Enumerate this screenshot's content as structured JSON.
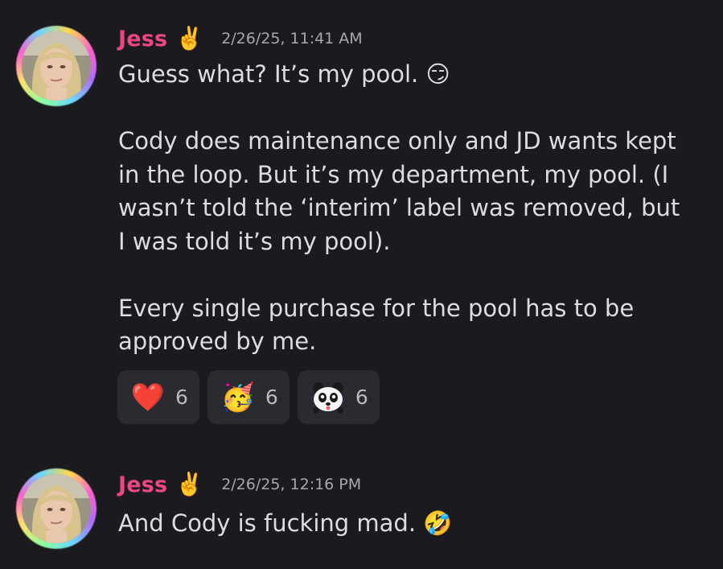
{
  "messages": [
    {
      "author": "Jess",
      "author_emoji": "✌️",
      "timestamp": "2/26/25, 11:41 AM",
      "paragraphs": [
        "Guess what? It’s my pool. 😏",
        "Cody does maintenance only and JD wants kept in the loop. But it’s my department, my pool. (I wasn’t told the ‘interim’ label was removed, but I was told it’s my pool).",
        "Every single purchase for the pool has to be approved by me."
      ],
      "reactions": [
        {
          "emoji": "❤️",
          "icon": "heart-icon",
          "count": "6"
        },
        {
          "emoji": "🥳",
          "icon": "party-face-icon",
          "count": "6"
        },
        {
          "emoji": "",
          "icon": "panda-icon",
          "count": "6"
        }
      ]
    },
    {
      "author": "Jess",
      "author_emoji": "✌️",
      "timestamp": "2/26/25, 12:16 PM",
      "paragraphs": [
        "And Cody is fucking mad. 🤣"
      ]
    }
  ],
  "colors": {
    "background": "#1b1b1f",
    "username": "#ee4583",
    "text": "#dcdde1",
    "timestamp": "#a6a8ae",
    "reaction_bg": "#2a2b30"
  }
}
